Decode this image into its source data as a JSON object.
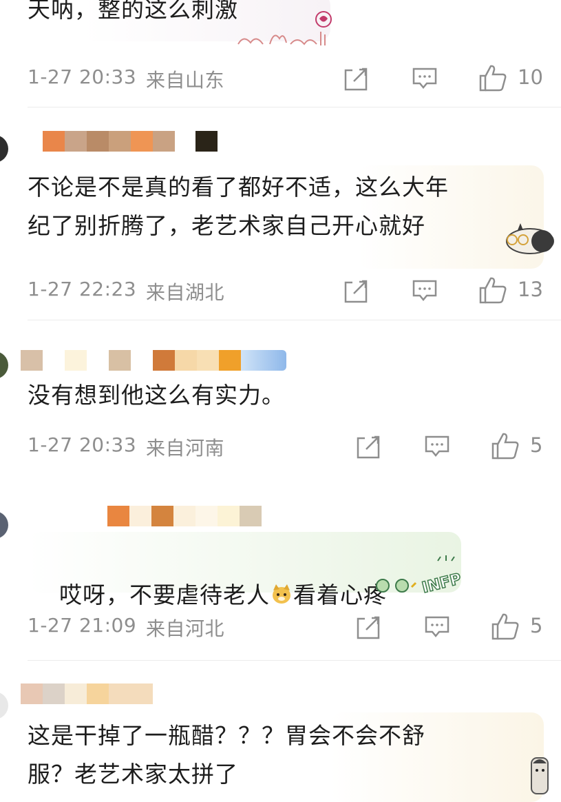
{
  "comments": [
    {
      "text": "天呐，整的这么刺激",
      "date": "1-27 20:33",
      "location": "来自山东",
      "likes": "10"
    },
    {
      "text": "不论是不是真的看了都好不适，这么大年\n纪了别折腾了，老艺术家自己开心就好",
      "date": "1-27 22:23",
      "location": "来自湖北",
      "likes": "13"
    },
    {
      "text": "没有想到他这么有实力。",
      "date": "1-27 20:33",
      "location": "来自河南",
      "likes": "5"
    },
    {
      "text_before": "哎呀，不要虐待老人",
      "text_after": "看着心疼",
      "date": "1-27 21:09",
      "location": "来自河北",
      "likes": "5",
      "sticker_text": "INFP"
    },
    {
      "text": "这是干掉了一瓶醋？？？胃会不会不舒\n服？老艺术家太拼了"
    }
  ],
  "icons": {
    "share": "share-icon",
    "comment": "comment-icon",
    "like": "thumbs-up-icon"
  },
  "colors": {
    "meta": "#8e8e8e",
    "text": "#1d1d1d",
    "divider": "#ececec"
  }
}
